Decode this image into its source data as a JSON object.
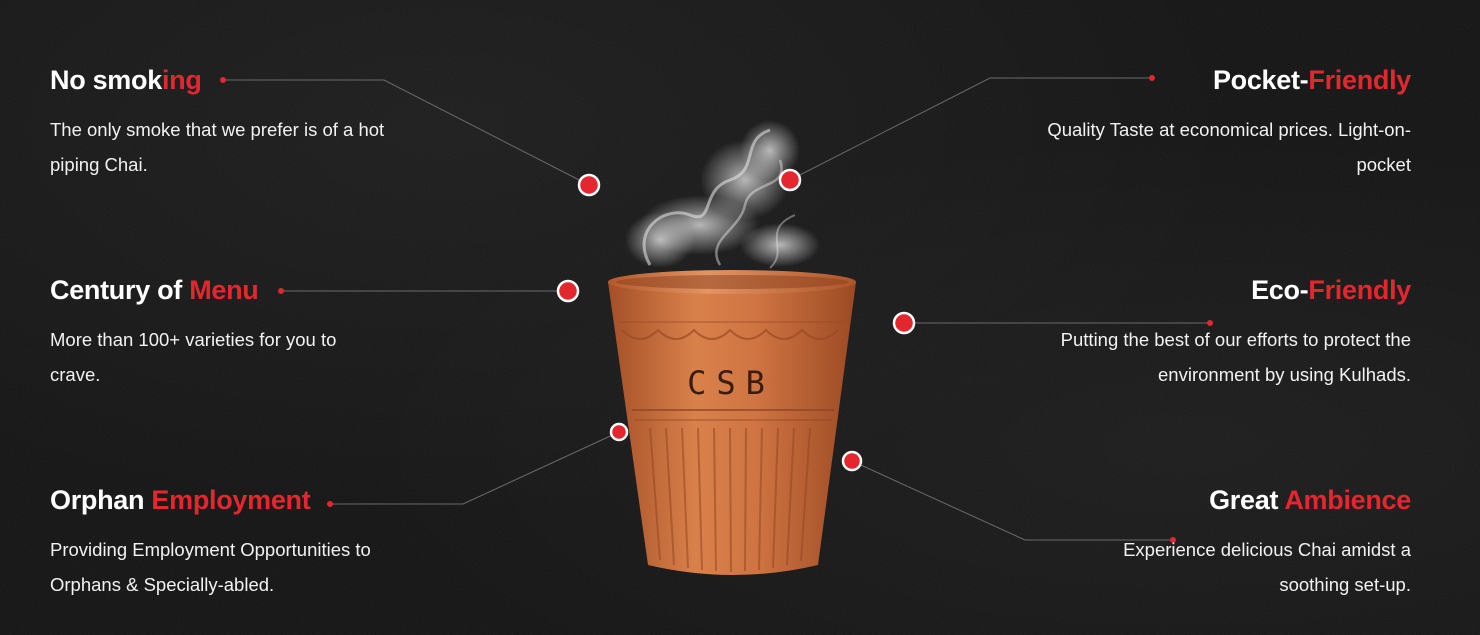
{
  "features": [
    {
      "title_plain": "No smok",
      "title_accent": "ing",
      "title_tail": "",
      "desc": "The only smoke that we prefer is of a hot piping Chai."
    },
    {
      "title_plain": "Century of ",
      "title_accent": "Menu",
      "title_tail": "",
      "desc": "More than 100+ varieties for you to crave."
    },
    {
      "title_plain": "Orphan ",
      "title_accent": "Employment",
      "title_tail": "",
      "desc": "Providing Employment Opportunities to Orphans & Specially-abled."
    },
    {
      "title_plain": "Pocket-",
      "title_accent": "Friendly",
      "title_tail": "",
      "desc": "Quality Taste at economical prices. Light-on-pocket"
    },
    {
      "title_plain": "Eco-",
      "title_accent": "Friendly",
      "title_tail": "",
      "desc": "Putting the best of our efforts to protect the environment by using Kulhads."
    },
    {
      "title_plain": "Great ",
      "title_accent": "Ambience",
      "title_tail": "",
      "desc": "Experience delicious Chai amidst a soothing set-up."
    }
  ],
  "cup": {
    "label": "CSB"
  },
  "colors": {
    "accent": "#e4262f",
    "background": "#121212",
    "clay": "#c86a3a"
  }
}
